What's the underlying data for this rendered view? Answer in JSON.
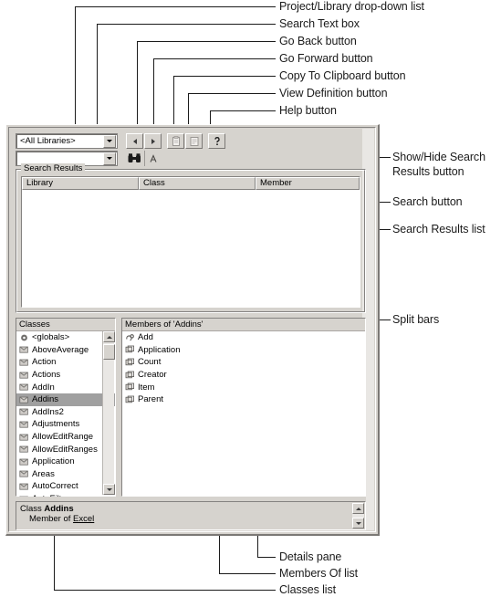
{
  "annotations": {
    "top": [
      "Project/Library drop-down list",
      "Search Text box",
      "Go Back button",
      "Go Forward button",
      "Copy To Clipboard button",
      "View Definition button",
      "Help button"
    ],
    "right": [
      "Show/Hide Search",
      "Results button",
      "Search button",
      "Search Results list",
      "Split bars"
    ],
    "bottom": [
      "Details pane",
      "Members Of list",
      "Classes list"
    ]
  },
  "toolbar": {
    "library_combo": {
      "value": "<All Libraries>",
      "arrow_icon": "chevron-down-icon"
    },
    "search_combo": {
      "value": "",
      "placeholder": "",
      "arrow_icon": "chevron-down-icon"
    },
    "buttons": [
      {
        "name": "go-back-button",
        "icon": "triangle-left-icon",
        "label": "Go Back",
        "enabled": false
      },
      {
        "name": "go-forward-button",
        "icon": "triangle-right-icon",
        "label": "Go Forward",
        "enabled": false
      },
      {
        "name": "copy-to-clipboard-button",
        "icon": "clipboard-icon",
        "label": "Copy To Clipboard",
        "enabled": false
      },
      {
        "name": "view-definition-button",
        "icon": "definition-icon",
        "label": "View Definition",
        "enabled": false
      },
      {
        "name": "help-button",
        "icon": "question-mark-icon",
        "label": "Help",
        "enabled": true
      }
    ],
    "search_button": {
      "icon": "binoculars-icon",
      "label": "Search"
    },
    "show_hide_button": {
      "icon": "show-hide-results-icon",
      "label": "Show/Hide Search Results"
    }
  },
  "search_results": {
    "group_title": "Search Results",
    "columns": [
      "Library",
      "Class",
      "Member"
    ],
    "rows": []
  },
  "classes_pane": {
    "title": "Classes",
    "selected": "Addins",
    "items": [
      {
        "label": "<globals>",
        "icon": "globals-icon"
      },
      {
        "label": "AboveAverage",
        "icon": "class-icon"
      },
      {
        "label": "Action",
        "icon": "class-icon"
      },
      {
        "label": "Actions",
        "icon": "class-icon"
      },
      {
        "label": "AddIn",
        "icon": "class-icon"
      },
      {
        "label": "Addins",
        "icon": "class-icon"
      },
      {
        "label": "AddIns2",
        "icon": "class-icon"
      },
      {
        "label": "Adjustments",
        "icon": "class-icon"
      },
      {
        "label": "AllowEditRange",
        "icon": "class-icon"
      },
      {
        "label": "AllowEditRanges",
        "icon": "class-icon"
      },
      {
        "label": "Application",
        "icon": "class-icon"
      },
      {
        "label": "Areas",
        "icon": "class-icon"
      },
      {
        "label": "AutoCorrect",
        "icon": "class-icon"
      },
      {
        "label": "AutoFilter",
        "icon": "class-icon"
      }
    ]
  },
  "members_pane": {
    "title": "Members of 'Addins'",
    "items": [
      {
        "label": "Add",
        "icon": "method-icon"
      },
      {
        "label": "Application",
        "icon": "property-icon"
      },
      {
        "label": "Count",
        "icon": "property-icon"
      },
      {
        "label": "Creator",
        "icon": "property-icon"
      },
      {
        "label": "Item",
        "icon": "property-icon"
      },
      {
        "label": "Parent",
        "icon": "property-icon"
      }
    ]
  },
  "details": {
    "line1_prefix": "Class ",
    "line1_name": "Addins",
    "line2_prefix": "Member of ",
    "line2_link": "Excel"
  },
  "colors": {
    "face": "#d6d3ce",
    "list_bg": "#ffffff",
    "selection": "#a0a0a0",
    "shadow": "#848280",
    "text": "#000000"
  }
}
